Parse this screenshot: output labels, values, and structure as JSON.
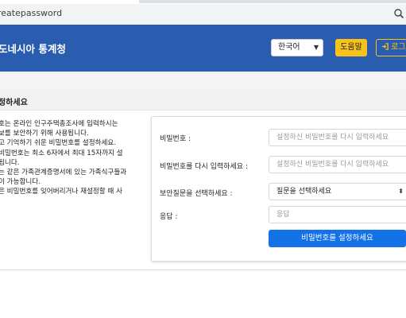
{
  "browser": {
    "url": "reatepassword"
  },
  "header": {
    "title": "도네시아 통계청",
    "language_selected": "한국어",
    "help_label": "도움말",
    "login_label": "로그"
  },
  "section": {
    "title": "정하세요"
  },
  "info": {
    "lines": [
      "호는 온라인 인구주택총조사에 입력하시는",
      "보를 보안하기 위해 사용됩니다.",
      "고 기억하기 쉬운 비밀번호를 설정하세요.",
      "비밀번호는 최소 6자에서 최대 15자까지 설",
      "됩니다.",
      "는 같은 가족관계증명서에 있는 가족식구들과",
      "이 가능합니다.",
      "은 비밀번호를 잊어버리거나 재설정할 때 사"
    ]
  },
  "form": {
    "password_label": "비밀번호 :",
    "password_placeholder": "설정하신 비밀번호를 다시 입력하세요",
    "confirm_label": "비밀번호를 다시 입력하세요 :",
    "confirm_placeholder": "설정하신 비밀번호를 다시 입력하세요",
    "question_label": "보안질문을 선택하세요 :",
    "question_selected": "질문을 선택하세요",
    "answer_label": "응답 :",
    "answer_placeholder": "응답",
    "submit_label": "비밀번호를 설정하세요"
  },
  "colors": {
    "header_blue": "#2a5db0",
    "accent_yellow": "#f7c21a",
    "submit_blue": "#1472e8"
  },
  "icons": {
    "zoom": "magnifier-icon",
    "login": "sign-in-icon"
  }
}
